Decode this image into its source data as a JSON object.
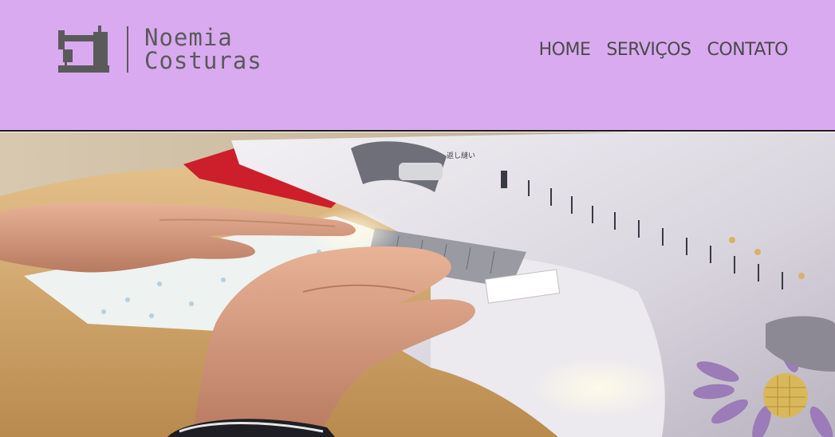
{
  "brand": {
    "line1": "Noemia",
    "line2": "Costuras",
    "logo_icon": "sewing-machine-icon"
  },
  "nav": {
    "items": [
      {
        "label": "HOME"
      },
      {
        "label": "SERVIÇOS"
      },
      {
        "label": "CONTATO"
      }
    ]
  },
  "hero": {
    "image": "sewing-machine-photo",
    "machine_label": "返し縫い"
  },
  "colors": {
    "header_bg": "#d9aaf0",
    "text": "#4a4a4a",
    "logo": "#5a5a5a"
  }
}
